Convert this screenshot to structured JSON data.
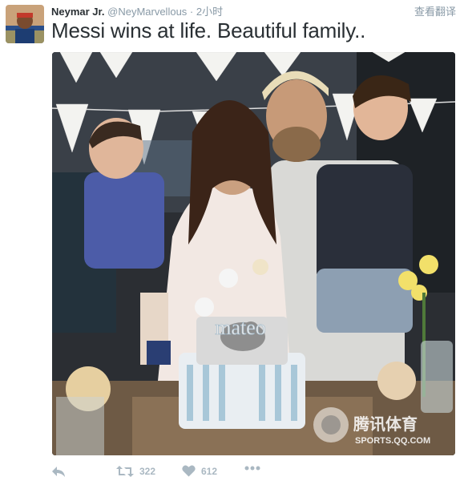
{
  "tweet": {
    "author_name": "Neymar Jr.",
    "handle": "@NeyMarvellous",
    "separator": "·",
    "time": "2小时",
    "translate_label": "查看翻译",
    "text": "Messi wins at life. Beautiful family.."
  },
  "photo": {
    "cake_topper_text": "mateo",
    "watermark_brand": "腾讯体育",
    "watermark_url": "SPORTS.QQ.COM"
  },
  "actions": {
    "retweet_count": "322",
    "like_count": "612"
  },
  "icons": {
    "reply": "reply-icon",
    "retweet": "retweet-icon",
    "like": "heart-icon",
    "more": "more-icon"
  },
  "colors": {
    "text": "#292f33",
    "muted": "#8899a6",
    "action_icon": "#aab8c2"
  }
}
